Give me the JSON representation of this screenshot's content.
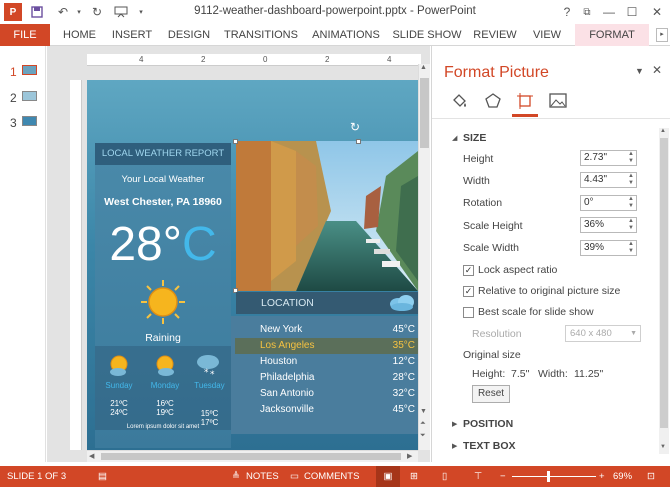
{
  "title": "9112-weather-dashboard-powerpoint.pptx - PowerPoint",
  "window_controls": {
    "help": "?",
    "restore": "⧉",
    "minimize": "—",
    "maximize": "☐",
    "close": "✕"
  },
  "tabs": [
    "FILE",
    "HOME",
    "INSERT",
    "DESIGN",
    "TRANSITIONS",
    "ANIMATIONS",
    "SLIDE SHOW",
    "REVIEW",
    "VIEW",
    "FORMAT"
  ],
  "thumbnails": [
    "1",
    "2",
    "3"
  ],
  "ruler_marks": [
    "4",
    "2",
    "0",
    "2",
    "4"
  ],
  "slide": {
    "header": "LOCAL WEATHER REPORT",
    "subtitle": "Your Local Weather",
    "city": "West Chester, PA 18960",
    "temperature": "28°C",
    "temp_number": "28°",
    "temp_unit": "C",
    "condition": "Raining",
    "forecast": [
      {
        "day": "Sunday",
        "temps": [
          "21ºC",
          "24ºC"
        ]
      },
      {
        "day": "Monday",
        "temps": [
          "16ºC",
          "19ºC"
        ]
      },
      {
        "day": "Tuesday",
        "temps": [
          "15ºC",
          "17ºC"
        ]
      }
    ],
    "footer": "Lorem ipsum dolor sit amet",
    "location_label": "LOCATION",
    "cities": [
      {
        "name": "New York",
        "temp": "45°C"
      },
      {
        "name": "Los  Angeles",
        "temp": "35°C"
      },
      {
        "name": "Houston",
        "temp": "12°C"
      },
      {
        "name": "Philadelphia",
        "temp": "28°C"
      },
      {
        "name": "San Antonio",
        "temp": "32°C"
      },
      {
        "name": "Jacksonville",
        "temp": "45°C"
      }
    ]
  },
  "pane": {
    "title": "Format Picture",
    "section_size": "SIZE",
    "height_label": "Height",
    "height_value": "2.73\"",
    "width_label": "Width",
    "width_value": "4.43\"",
    "rotation_label": "Rotation",
    "rotation_value": "0°",
    "scale_height_label": "Scale Height",
    "scale_height_value": "36%",
    "scale_width_label": "Scale Width",
    "scale_width_value": "39%",
    "lock_aspect": "Lock aspect ratio",
    "relative_size": "Relative to original picture size",
    "best_scale": "Best scale for slide show",
    "resolution_label": "Resolution",
    "resolution_value": "640 x 480",
    "original_size_label": "Original size",
    "orig_height_label": "Height:",
    "orig_height_value": "7.5\"",
    "orig_width_label": "Width:",
    "orig_width_value": "11.25\"",
    "reset": "Reset",
    "section_position": "POSITION",
    "section_textbox": "TEXT BOX"
  },
  "status": {
    "slide": "SLIDE 1 OF 3",
    "notes": "NOTES",
    "comments": "COMMENTS",
    "zoom": "69%",
    "zoom_fraction": 0.69
  },
  "colors": {
    "accent": "#d24726",
    "format_tab": "#fbe1e6",
    "sun": "#f6c241",
    "temp_unit": "#43b8ea"
  }
}
